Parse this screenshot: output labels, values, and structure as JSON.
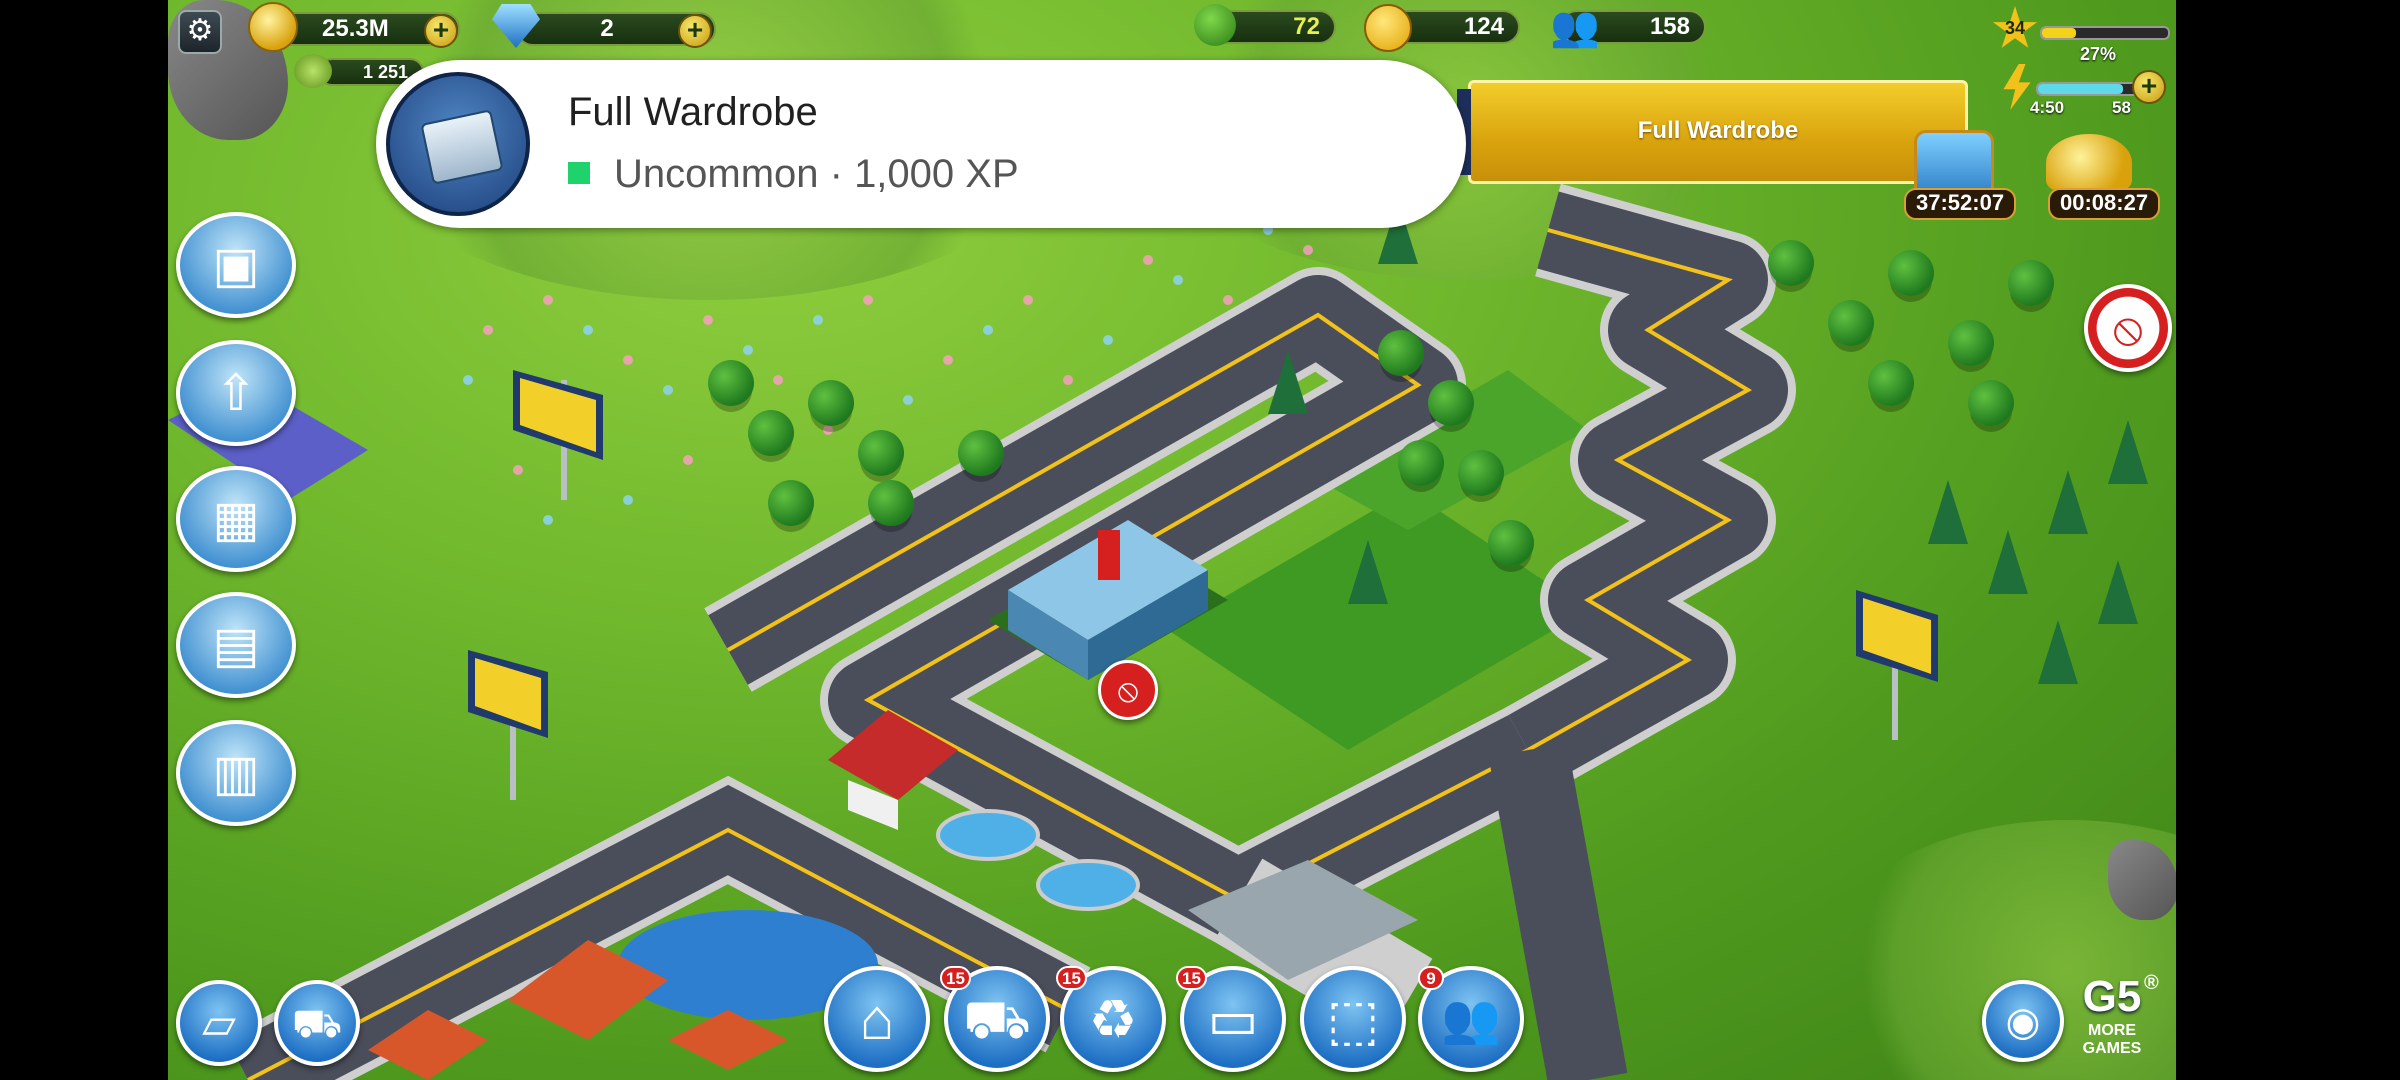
{
  "hud": {
    "coins": "25.3M",
    "gems": "2",
    "secondary_currency": "1 251",
    "trees": "72",
    "happiness": "124",
    "population": "158",
    "level": "34",
    "xp_percent_label": "27%",
    "xp_progress": 0.27,
    "energy_timer": "4:50",
    "energy_value": "58",
    "energy_progress": 0.85
  },
  "notification": {
    "title": "Full Wardrobe",
    "rarity": "Uncommon",
    "separator": " · ",
    "xp": "1,000 XP",
    "rarity_color": "#1fd26b"
  },
  "banner": {
    "label": "Full Wardrobe"
  },
  "timers": {
    "chest_timer": "37:52:07",
    "coins_timer": "00:08:27"
  },
  "bottom_bar": {
    "badges": [
      "15",
      "15",
      "15",
      "9"
    ]
  },
  "g5": {
    "logo": "G5",
    "more_line1": "MORE",
    "more_line2": "GAMES",
    "registered": "®"
  },
  "icons": [
    "settings-gear-icon",
    "coins-icon",
    "gem-icon",
    "tree-icon",
    "smiley-icon",
    "people-icon",
    "star-level-icon",
    "lightning-icon",
    "plus-icon",
    "camera-icon",
    "construction-crane-icon",
    "truck-icon",
    "recycle-truck-icon",
    "bus-icon",
    "box-icon",
    "g5-friends-icon"
  ]
}
